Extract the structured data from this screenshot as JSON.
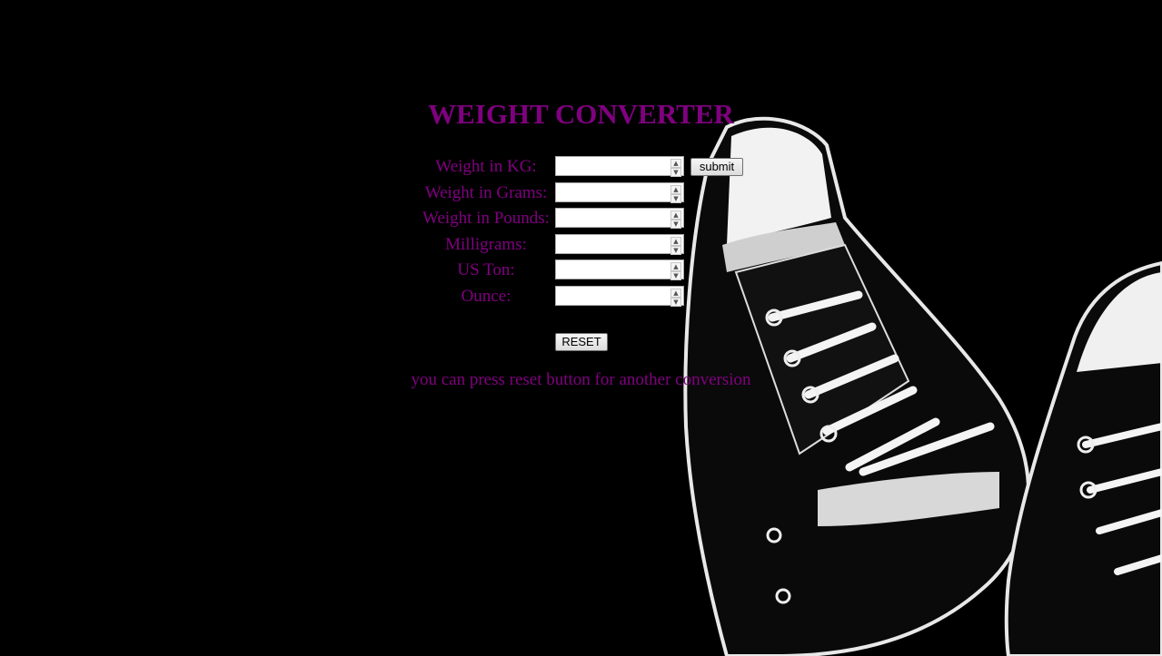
{
  "page": {
    "title": "WEIGHT CONVERTER"
  },
  "colors": {
    "background": "#000000",
    "text": "#800080"
  },
  "background_image": {
    "icon": "sneakers-illustration"
  },
  "fields": [
    {
      "label": "Weight in KG:",
      "value": ""
    },
    {
      "label": "Weight in Grams:",
      "value": ""
    },
    {
      "label": "Weight in Pounds:",
      "value": ""
    },
    {
      "label": "Milligrams:",
      "value": ""
    },
    {
      "label": "US Ton:",
      "value": ""
    },
    {
      "label": "Ounce:",
      "value": ""
    }
  ],
  "buttons": {
    "submit": "submit",
    "reset": "RESET"
  },
  "hint": "you can press reset button for another conversion"
}
